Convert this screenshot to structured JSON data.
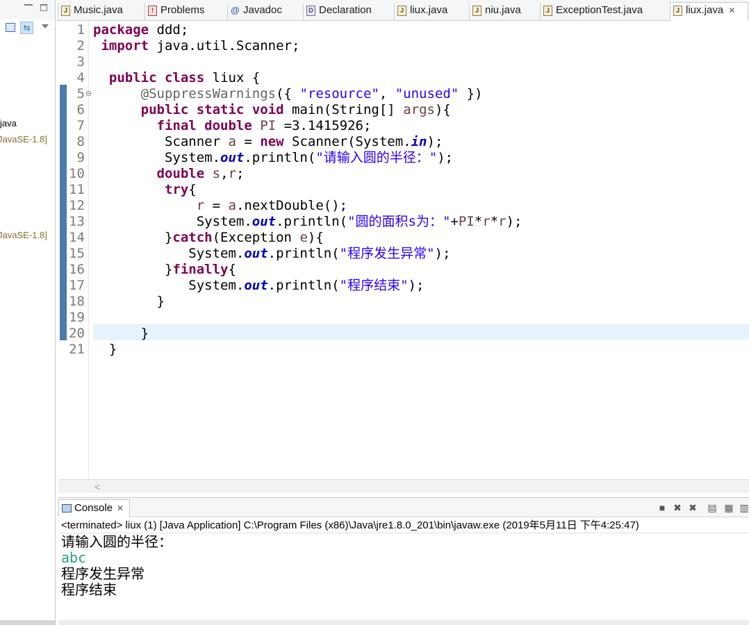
{
  "left_pane": {
    "item_java": "java",
    "lib_1": "JavaSE-1.8]",
    "lib_2": "JavaSE-1.8]"
  },
  "tabs": [
    {
      "label": "Music.java",
      "icon": "java-file-icon"
    },
    {
      "label": "Problems",
      "icon": "problems-icon"
    },
    {
      "label": "Javadoc",
      "icon": "javadoc-icon"
    },
    {
      "label": "Declaration",
      "icon": "declaration-icon"
    },
    {
      "label": "liux.java",
      "icon": "java-file-icon"
    },
    {
      "label": "niu.java",
      "icon": "java-file-icon"
    },
    {
      "label": "ExceptionTest.java",
      "icon": "java-file-icon"
    },
    {
      "label": "liux.java",
      "icon": "java-file-icon",
      "active": true
    }
  ],
  "editor": {
    "line_numbers": [
      "1",
      "2",
      "3",
      "4",
      "5",
      "6",
      "7",
      "8",
      "9",
      "10",
      "11",
      "12",
      "13",
      "14",
      "15",
      "16",
      "17",
      "18",
      "19",
      "20",
      "21"
    ],
    "current_line": 20,
    "lines": [
      [
        {
          "t": "package",
          "c": "kw"
        },
        {
          "t": " ddd;"
        }
      ],
      [
        {
          "t": " "
        },
        {
          "t": "import",
          "c": "kw"
        },
        {
          "t": " java.util.Scanner;"
        }
      ],
      [
        {
          "t": ""
        }
      ],
      [
        {
          "t": "  "
        },
        {
          "t": "public",
          "c": "kw"
        },
        {
          "t": " "
        },
        {
          "t": "class",
          "c": "kw"
        },
        {
          "t": " liux {"
        }
      ],
      [
        {
          "t": "      "
        },
        {
          "t": "@SuppressWarnings",
          "c": "ann"
        },
        {
          "t": "({ "
        },
        {
          "t": "\"resource\"",
          "c": "str"
        },
        {
          "t": ", "
        },
        {
          "t": "\"unused\"",
          "c": "str"
        },
        {
          "t": " })"
        }
      ],
      [
        {
          "t": "      "
        },
        {
          "t": "public",
          "c": "kw"
        },
        {
          "t": " "
        },
        {
          "t": "static",
          "c": "kw"
        },
        {
          "t": " "
        },
        {
          "t": "void",
          "c": "kw"
        },
        {
          "t": " main(String[] "
        },
        {
          "t": "args",
          "c": "var"
        },
        {
          "t": "){"
        }
      ],
      [
        {
          "t": "        "
        },
        {
          "t": "final",
          "c": "kw"
        },
        {
          "t": " "
        },
        {
          "t": "double",
          "c": "kw"
        },
        {
          "t": " "
        },
        {
          "t": "PI",
          "c": "var"
        },
        {
          "t": " =3.1415926;"
        }
      ],
      [
        {
          "t": "         Scanner "
        },
        {
          "t": "a",
          "c": "var"
        },
        {
          "t": " = "
        },
        {
          "t": "new",
          "c": "kw"
        },
        {
          "t": " Scanner(System."
        },
        {
          "t": "in",
          "c": "fld"
        },
        {
          "t": ");"
        }
      ],
      [
        {
          "t": "         System."
        },
        {
          "t": "out",
          "c": "fld"
        },
        {
          "t": ".println("
        },
        {
          "t": "\"请输入圆的半径：\"",
          "c": "str"
        },
        {
          "t": ");"
        }
      ],
      [
        {
          "t": "        "
        },
        {
          "t": "double",
          "c": "kw"
        },
        {
          "t": " "
        },
        {
          "t": "s",
          "c": "var"
        },
        {
          "t": ","
        },
        {
          "t": "r",
          "c": "var"
        },
        {
          "t": ";"
        }
      ],
      [
        {
          "t": "         "
        },
        {
          "t": "try",
          "c": "kw"
        },
        {
          "t": "{"
        }
      ],
      [
        {
          "t": "             "
        },
        {
          "t": "r",
          "c": "var"
        },
        {
          "t": " = "
        },
        {
          "t": "a",
          "c": "var"
        },
        {
          "t": ".nextDouble();"
        }
      ],
      [
        {
          "t": "             System."
        },
        {
          "t": "out",
          "c": "fld"
        },
        {
          "t": ".println("
        },
        {
          "t": "\"圆的面积s为：\"",
          "c": "str"
        },
        {
          "t": "+"
        },
        {
          "t": "PI",
          "c": "var"
        },
        {
          "t": "*"
        },
        {
          "t": "r",
          "c": "var"
        },
        {
          "t": "*"
        },
        {
          "t": "r",
          "c": "var"
        },
        {
          "t": ");"
        }
      ],
      [
        {
          "t": "         }"
        },
        {
          "t": "catch",
          "c": "kw"
        },
        {
          "t": "(Exception "
        },
        {
          "t": "e",
          "c": "var"
        },
        {
          "t": "){"
        }
      ],
      [
        {
          "t": "            System."
        },
        {
          "t": "out",
          "c": "fld"
        },
        {
          "t": ".println("
        },
        {
          "t": "\"程序发生异常\"",
          "c": "str"
        },
        {
          "t": ");"
        }
      ],
      [
        {
          "t": "         }"
        },
        {
          "t": "finally",
          "c": "kw"
        },
        {
          "t": "{"
        }
      ],
      [
        {
          "t": "            System."
        },
        {
          "t": "out",
          "c": "fld"
        },
        {
          "t": ".println("
        },
        {
          "t": "\"程序结束\"",
          "c": "str"
        },
        {
          "t": ");"
        }
      ],
      [
        {
          "t": "        }"
        }
      ],
      [
        {
          "t": ""
        }
      ],
      [
        {
          "t": "      }"
        }
      ],
      [
        {
          "t": "  }"
        }
      ]
    ]
  },
  "console": {
    "tab_label": "Console",
    "status": "<terminated> liux (1) [Java Application] C:\\Program Files (x86)\\Java\\jre1.8.0_201\\bin\\javaw.exe (2019年5月11日 下午4:25:47)",
    "output": [
      {
        "text": "请输入圆的半径：",
        "kind": "normal"
      },
      {
        "text": "abc",
        "kind": "input"
      },
      {
        "text": "程序发生异常",
        "kind": "normal"
      },
      {
        "text": "程序结束",
        "kind": "normal"
      }
    ]
  },
  "colors": {
    "keyword": "#7f0055",
    "string": "#2a00ff",
    "annotation": "#646464",
    "static_field": "#0000c0",
    "user_input": "#2ba37c",
    "current_line": "#e8f2fe"
  }
}
